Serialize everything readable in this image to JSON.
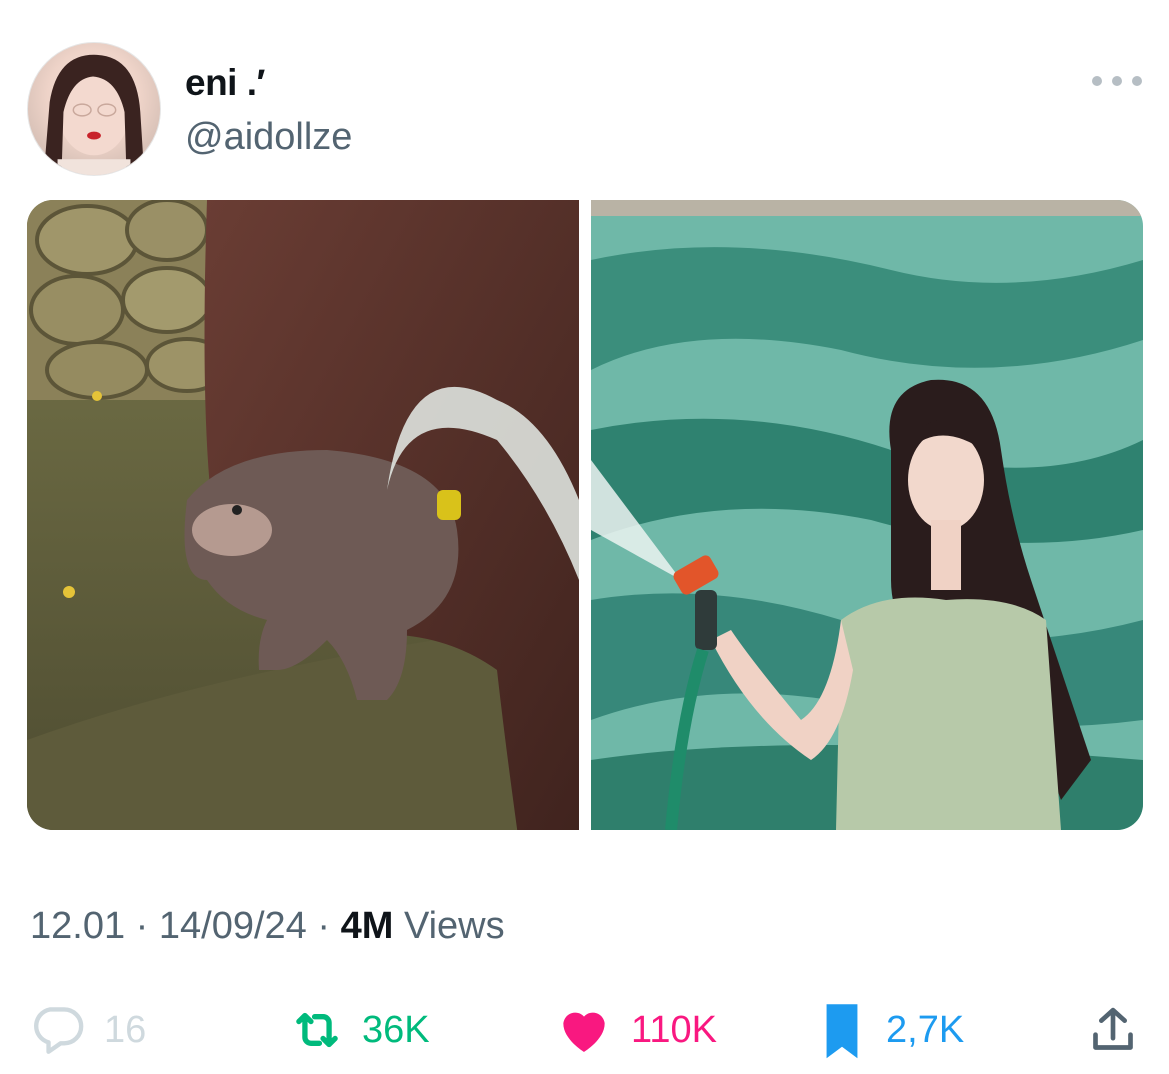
{
  "tweet": {
    "display_name": "eni .′",
    "handle": "@aidollze",
    "time": "12.01",
    "date": "14/09/24",
    "separator": "·",
    "views_count": "4M",
    "views_label": "Views",
    "media": [
      {
        "description_icon": "hippo-photo"
      },
      {
        "description_icon": "woman-with-hose-photo"
      }
    ]
  },
  "actions": {
    "reply_count": "16",
    "retweet_count": "36K",
    "like_count": "110K",
    "bookmark_count": "2,7K",
    "icons": [
      "reply-icon",
      "retweet-icon",
      "heart-icon",
      "bookmark-icon",
      "share-icon"
    ]
  },
  "colors": {
    "text_primary": "#0f1419",
    "text_secondary": "#536471",
    "retweet_green": "#00ba7c",
    "like_pink": "#f91880",
    "bookmark_blue": "#1d9bf0",
    "reply_gray": "#cfd9de"
  }
}
